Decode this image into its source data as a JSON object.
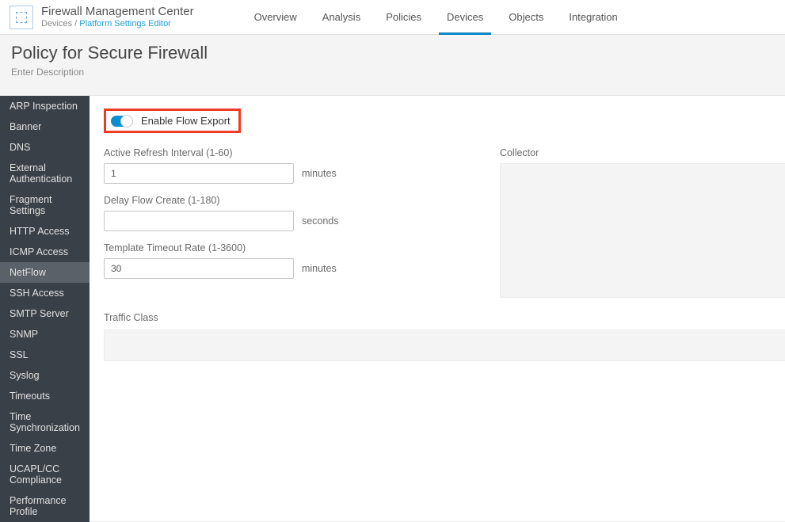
{
  "app": {
    "title": "Firewall Management Center",
    "breadcrumb": {
      "root": "Devices",
      "sep": " / ",
      "current": "Platform Settings Editor"
    }
  },
  "nav": {
    "items": [
      {
        "label": "Overview"
      },
      {
        "label": "Analysis"
      },
      {
        "label": "Policies"
      },
      {
        "label": "Devices"
      },
      {
        "label": "Objects"
      },
      {
        "label": "Integration"
      }
    ],
    "activeIndex": 3
  },
  "page": {
    "title": "Policy for Secure Firewall",
    "desc": "Enter Description"
  },
  "sidebar": {
    "items": [
      "ARP Inspection",
      "Banner",
      "DNS",
      "External Authentication",
      "Fragment Settings",
      "HTTP Access",
      "ICMP Access",
      "NetFlow",
      "SSH Access",
      "SMTP Server",
      "SNMP",
      "SSL",
      "Syslog",
      "Timeouts",
      "Time Synchronization",
      "Time Zone",
      "UCAPL/CC Compliance",
      "Performance Profile"
    ],
    "activeIndex": 7
  },
  "form": {
    "enableFlowExportLabel": "Enable Flow Export",
    "activeRefresh": {
      "label": "Active Refresh Interval (1-60)",
      "value": "1",
      "unit": "minutes"
    },
    "delayFlow": {
      "label": "Delay Flow Create (1-180)",
      "value": "",
      "unit": "seconds"
    },
    "templateTimeout": {
      "label": "Template Timeout Rate (1-3600)",
      "value": "30",
      "unit": "minutes"
    },
    "collectorLabel": "Collector",
    "trafficClassLabel": "Traffic Class"
  }
}
